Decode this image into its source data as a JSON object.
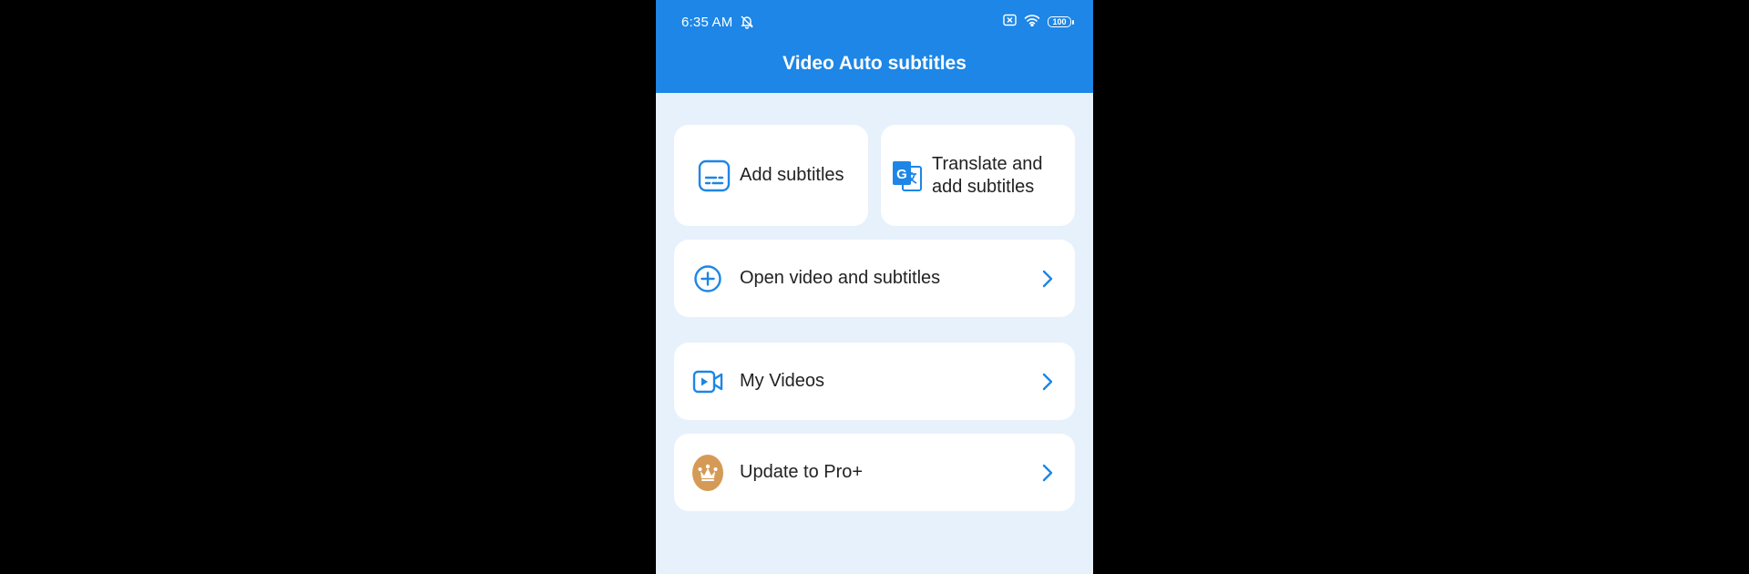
{
  "status_bar": {
    "time": "6:35 AM",
    "battery": "100",
    "icons": [
      "bell-off-icon",
      "sim-x-icon",
      "wifi-icon",
      "battery-icon"
    ]
  },
  "app": {
    "title": "Video Auto subtitles",
    "accent_color": "#1d86e6",
    "background_color": "#e7f1fc"
  },
  "quick_actions": [
    {
      "label": "Add subtitles",
      "icon": "subtitles-icon"
    },
    {
      "label_line1": "Translate and",
      "label_line2": "add subtitles",
      "icon": "translate-icon"
    }
  ],
  "menu": [
    {
      "label": "Open video and subtitles",
      "icon": "plus-circle-icon"
    },
    {
      "label": "My Videos",
      "icon": "video-camera-icon"
    },
    {
      "label": "Update to Pro+",
      "icon": "crown-icon",
      "icon_color": "#d59a55"
    }
  ]
}
